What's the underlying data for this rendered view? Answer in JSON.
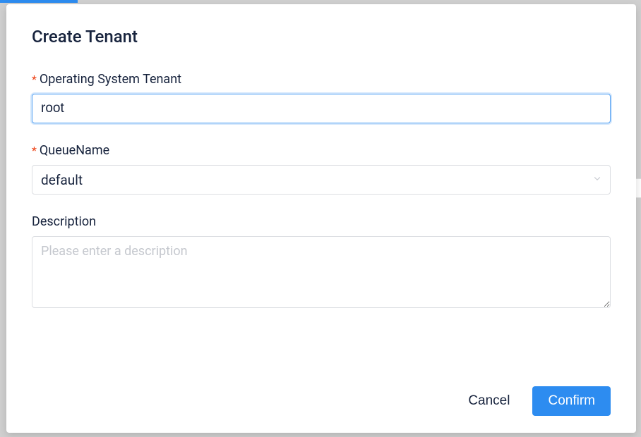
{
  "modal": {
    "title": "Create Tenant",
    "fields": {
      "tenant": {
        "label": "Operating System Tenant",
        "required_marker": "*",
        "value": "root"
      },
      "queue": {
        "label": "QueueName",
        "required_marker": "*",
        "selected": "default"
      },
      "description": {
        "label": "Description",
        "placeholder": "Please enter a description",
        "value": ""
      }
    },
    "buttons": {
      "cancel": "Cancel",
      "confirm": "Confirm"
    }
  }
}
